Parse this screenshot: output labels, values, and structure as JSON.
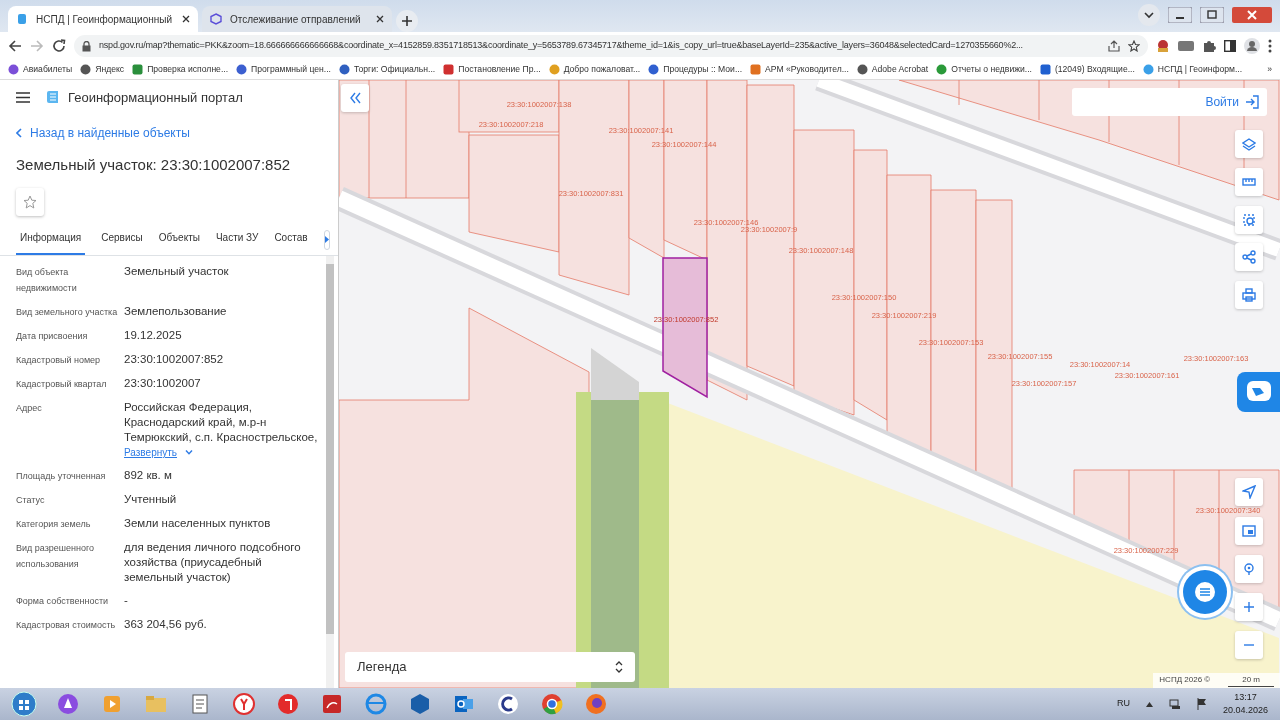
{
  "browser": {
    "tabs": [
      {
        "title": "НСПД | Геоинформационный",
        "selected": true
      },
      {
        "title": "Отслеживание отправлений",
        "selected": false
      }
    ],
    "url": "nspd.gov.ru/map?thematic=PKK&zoom=18.666666666666668&coordinate_x=4152859.8351718513&coordinate_y=5653789.67345717&theme_id=1&is_copy_url=true&baseLayerId=235&active_layers=36048&selectedCard=1270355660%2...",
    "bookmarks": [
      "Авиабилеты",
      "Яндекс",
      "Проверка исполне...",
      "Программный цен...",
      "Торги: Официальн...",
      "Постановление Пр...",
      "Добро пожаловат...",
      "Процедуры :: Мои...",
      "АРМ «Руководител...",
      "Adobe Acrobat",
      "Отчеты о недвижи...",
      "(12049) Входящие...",
      "НСПД | Геоинформ..."
    ],
    "bookmarks_overflow": "»"
  },
  "app": {
    "title": "Геоинформационный портал",
    "back_link": "Назад в найденные объекты",
    "heading": "Земельный участок: 23:30:1002007:852",
    "favorite": false,
    "tabs": [
      {
        "label": "Информация",
        "selected": true
      },
      {
        "label": "Сервисы",
        "selected": false
      },
      {
        "label": "Объекты",
        "selected": false
      },
      {
        "label": "Части ЗУ",
        "selected": false
      },
      {
        "label": "Состав",
        "selected": false
      }
    ],
    "fields": [
      {
        "label": "Вид объекта недвижимости",
        "value": "Земельный участок"
      },
      {
        "label": "Вид земельного участка",
        "value": "Землепользование"
      },
      {
        "label": "Дата присвоения",
        "value": "19.12.2025"
      },
      {
        "label": "Кадастровый номер",
        "value": "23:30:1002007:852"
      },
      {
        "label": "Кадастровый квартал",
        "value": "23:30:1002007"
      },
      {
        "label": "Адрес",
        "value": "Российская Федерация, Краснодарский край, м.р-н Темрюкский, с.п. Краснострельское,",
        "expand_link": "Развернуть"
      },
      {
        "label": "Площадь уточненная",
        "value": "892 кв. м"
      },
      {
        "label": "Статус",
        "value": "Учтенный"
      },
      {
        "label": "Категория земель",
        "value": "Земли населенных пунктов"
      },
      {
        "label": "Вид разрешенного использования",
        "value": "для ведения личного подсобного хозяйства (приусадебный земельный участок)"
      },
      {
        "label": "Форма собственности",
        "value": "-"
      },
      {
        "label": "Кадастровая стоимость",
        "value": "363 204,56 руб."
      }
    ]
  },
  "map": {
    "login_button": "Войти",
    "parcels": [
      {
        "label": "23:30:1002007:138",
        "selected": false
      },
      {
        "label": "23:30:1002007:218",
        "selected": false
      },
      {
        "label": "23:30:1002007:141",
        "selected": false
      },
      {
        "label": "23:30:1002007:144",
        "selected": false
      },
      {
        "label": "23:30:1002007:831",
        "selected": false
      },
      {
        "label": "23:30:1002007:146",
        "selected": false
      },
      {
        "label": "23:30:1002007:9",
        "selected": false
      },
      {
        "label": "23:30:1002007:148",
        "selected": false
      },
      {
        "label": "23:30:1002007:852",
        "selected": true
      },
      {
        "label": "23:30:1002007:150",
        "selected": false
      },
      {
        "label": "23:30:1002007:219",
        "selected": false
      },
      {
        "label": "23:30:1002007:153",
        "selected": false
      },
      {
        "label": "23:30:1002007:155",
        "selected": false
      },
      {
        "label": "23:30:1002007:14",
        "selected": false
      },
      {
        "label": "23:30:1002007:163",
        "selected": false
      },
      {
        "label": "23:30:1002007:161",
        "selected": false
      },
      {
        "label": "23:30:1002007:157",
        "selected": false
      },
      {
        "label": "23:30:1002007:340",
        "selected": false
      },
      {
        "label": "23:30:1002007:229",
        "selected": false
      }
    ],
    "legend": "Легенда",
    "attribution": "НСПД 2026 ©",
    "scale": "20 m"
  },
  "taskbar": {
    "language": "RU",
    "time": "13:17",
    "date": "20.04.2026"
  }
}
